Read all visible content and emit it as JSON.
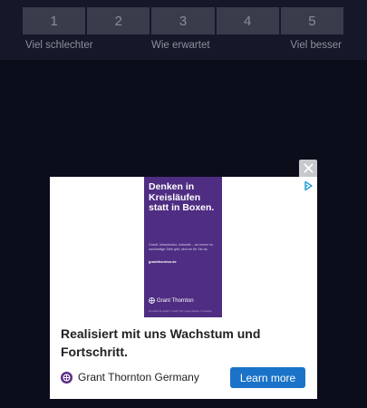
{
  "rating": {
    "options": [
      "1",
      "2",
      "3",
      "4",
      "5"
    ],
    "label_low": "Viel schlechter",
    "label_mid": "Wie erwartet",
    "label_high": "Viel besser"
  },
  "ad": {
    "creative": {
      "headline": "Denken in Kreisläufen statt in Boxen.",
      "body": "Grantt, Infrastruktur, Industrie – wo immer es nachhaltige Ziele gibt, sind wir für Sie da.",
      "url": "grantthornton.de",
      "logo_text": "Grant Thornton",
      "footer": "An instinct for growth™ | Audit | Tax | Legal | Advisory | Consulting"
    },
    "headline": "Realisiert mit uns Wachstum und Fortschritt.",
    "advertiser": "Grant Thornton Germany",
    "cta": "Learn more",
    "brand_color": "#4e2d82",
    "cta_color": "#1a73c8"
  },
  "icons": {
    "close": "close-icon",
    "adchoices": "adchoices-icon",
    "advertiser_logo": "grant-thornton-logo-icon"
  }
}
